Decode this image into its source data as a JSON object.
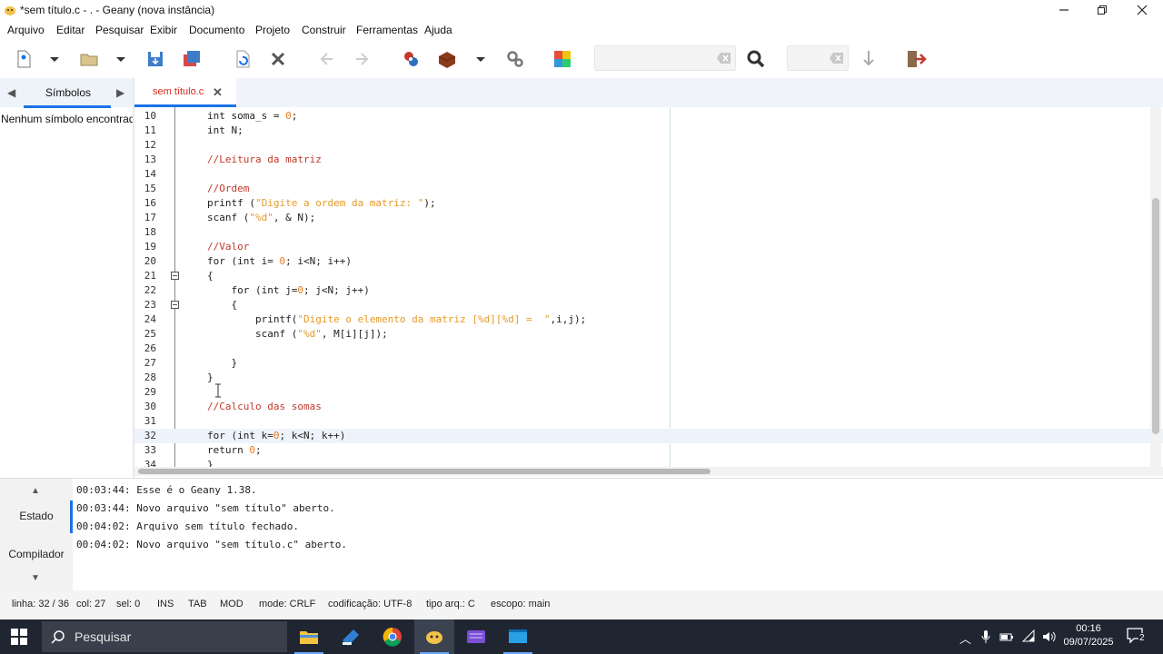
{
  "window": {
    "title": "*sem título.c - . - Geany (nova instância)",
    "minimize_icon": "minimize-icon",
    "restore_icon": "restore-icon",
    "close_icon": "close-icon"
  },
  "menu": [
    "Arquivo",
    "Editar",
    "Pesquisar",
    "Exibir",
    "Documento",
    "Projeto",
    "Construir",
    "Ferramentas",
    "Ajuda"
  ],
  "toolbar": {
    "search_placeholder": "",
    "goto_placeholder": ""
  },
  "sidebar": {
    "tab_label": "Símbolos",
    "empty_text": "Nenhum símbolo encontrado"
  },
  "editor": {
    "tab_label": "sem título.c",
    "current_line": 32,
    "lines": [
      {
        "n": "10",
        "code": "int soma_s = 0;"
      },
      {
        "n": "11",
        "code": "int N;"
      },
      {
        "n": "12",
        "code": ""
      },
      {
        "n": "13",
        "code": "//Leitura da matriz"
      },
      {
        "n": "14",
        "code": ""
      },
      {
        "n": "15",
        "code": "//Ordem"
      },
      {
        "n": "16",
        "code": "printf (\"Digite a ordem da matriz: \");"
      },
      {
        "n": "17",
        "code": "scanf (\"%d\", & N);"
      },
      {
        "n": "18",
        "code": ""
      },
      {
        "n": "19",
        "code": "//Valor"
      },
      {
        "n": "20",
        "code": "for (int i= 0; i<N; i++)"
      },
      {
        "n": "21",
        "code": "{"
      },
      {
        "n": "22",
        "code": "    for (int j=0; j<N; j++)"
      },
      {
        "n": "23",
        "code": "    {"
      },
      {
        "n": "24",
        "code": "        printf(\"Digite o elemento da matriz [%d][%d] =  \",i,j);"
      },
      {
        "n": "25",
        "code": "        scanf (\"%d\", M[i][j]);"
      },
      {
        "n": "26",
        "code": ""
      },
      {
        "n": "27",
        "code": "    }"
      },
      {
        "n": "28",
        "code": "}"
      },
      {
        "n": "29",
        "code": ""
      },
      {
        "n": "30",
        "code": "//Calculo das somas"
      },
      {
        "n": "31",
        "code": ""
      },
      {
        "n": "32",
        "code": "for (int k=0; k<N; k++)"
      },
      {
        "n": "33",
        "code": "return 0;"
      },
      {
        "n": "34",
        "code": "}"
      }
    ]
  },
  "messages": {
    "tabs": [
      "Estado",
      "Compilador"
    ],
    "log": [
      "00:03:44: Esse é o Geany 1.38.",
      "00:03:44: Novo arquivo \"sem título\" aberto.",
      "00:04:02: Arquivo sem título fechado.",
      "00:04:02: Novo arquivo \"sem título.c\" aberto."
    ]
  },
  "status": {
    "line": "linha: 32 / 36",
    "col": "col: 27",
    "sel": "sel: 0",
    "ins": "INS",
    "tab": "TAB",
    "mod": "MOD",
    "mode": "mode: CRLF",
    "encoding": "codificação: UTF-8",
    "filetype": "tipo arq.: C",
    "scope": "escopo: main"
  },
  "taskbar": {
    "search_label": "Pesquisar",
    "time": "00:16",
    "date": "09/07/2025",
    "notif_count": "2"
  },
  "colors": {
    "accent": "#1a73e8",
    "comment": "#c0392b",
    "string": "#e59a2a",
    "tab_label": "#d62b1a"
  }
}
